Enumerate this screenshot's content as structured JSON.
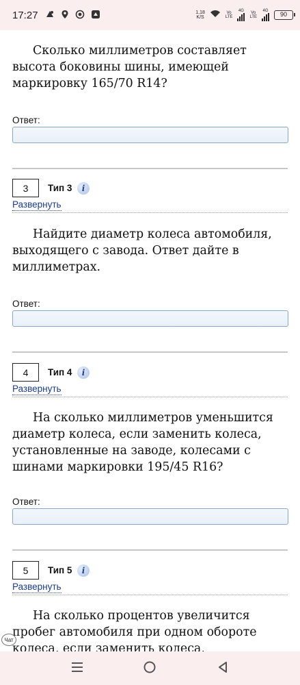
{
  "status_bar": {
    "time": "17:27",
    "net_speed_value": "1,18",
    "net_speed_unit": "K/S",
    "sim1_label_top": "Vo",
    "sim1_label_bottom": "LTE",
    "sim1_type": "4G",
    "sim2_label_top": "Vo",
    "sim2_label_bottom": "LTE",
    "sim2_type": "4G",
    "battery": "90",
    "icons": [
      "notification-icon",
      "location-icon",
      "sync-icon",
      "app-icon",
      "wifi-icon",
      "signal-icon"
    ]
  },
  "tasks": [
    {
      "question": "Сколько миллиметров составляет высота боковины шины, имеющей маркировку 165/70 R14?",
      "answer_label": "Ответ:"
    },
    {
      "number": "3",
      "type_label": "Тип 3",
      "expand_label": "Развернуть",
      "question": "Найдите диаметр колеса автомобиля, выходящего с завода. Ответ дайте в миллиметрах.",
      "answer_label": "Ответ:"
    },
    {
      "number": "4",
      "type_label": "Тип 4",
      "expand_label": "Развернуть",
      "question": "На сколько миллиметров уменьшится диаметр колеса, если заменить колеса, установленные на заводе, колесами с шинами маркировки 195/45 R16?",
      "answer_label": "Ответ:"
    },
    {
      "number": "5",
      "type_label": "Тип 5",
      "expand_label": "Развернуть",
      "question": "На сколько процентов увеличится пробег автомобиля при одном обороте колеса, если заменить колеса, установленные на"
    }
  ],
  "info_icon_glyph": "i",
  "chat_label": "Чат",
  "nav": {
    "buttons": [
      "menu-icon",
      "home-icon",
      "back-icon"
    ]
  },
  "colors": {
    "system_bar_bg": "#fbeeee",
    "link": "#1a3c8a",
    "input_border": "#8aa6c8",
    "divider": "#c7c7c7"
  }
}
